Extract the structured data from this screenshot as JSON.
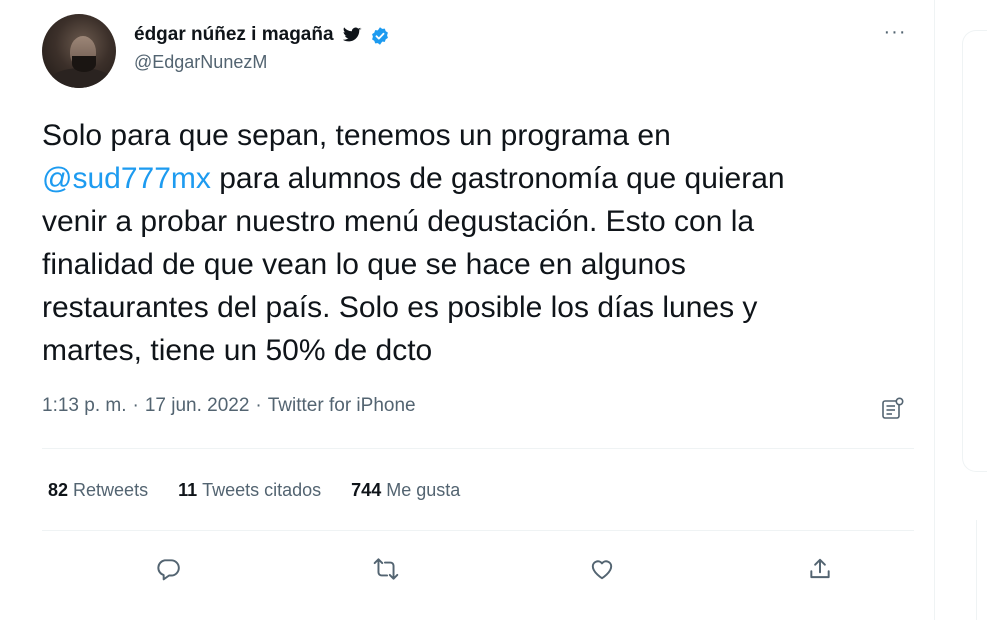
{
  "author": {
    "display_name": "édgar núñez i magaña",
    "handle": "@EdgarNunezM",
    "badges": [
      "twitter-bird-icon",
      "verified-badge-icon"
    ]
  },
  "more_label": "···",
  "tweet": {
    "text_before": "Solo para que sepan, tenemos un programa en\n",
    "mention": "@sud777mx",
    "text_after": " para alumnos de gastronomía que quieran\nvenir a probar nuestro menú degustación. Esto con la\nfinalidad de que vean lo que se hace en algunos\nrestaurantes del país. Solo es posible los días lunes y\nmartes, tiene un 50% de dcto"
  },
  "meta": {
    "time": "1:13 p. m.",
    "sep1": "·",
    "date": "17 jun. 2022",
    "sep2": "·",
    "source": "Twitter for iPhone"
  },
  "stats": {
    "retweets_count": "82",
    "retweets_label": "Retweets",
    "quotes_count": "11",
    "quotes_label": "Tweets citados",
    "likes_count": "744",
    "likes_label": "Me gusta"
  },
  "actions": [
    "reply-icon",
    "retweet-icon",
    "like-icon",
    "share-icon"
  ],
  "colors": {
    "accent": "#1d9bf0",
    "text": "#0f1419",
    "secondary": "#536471",
    "divider": "#eff3f4"
  }
}
